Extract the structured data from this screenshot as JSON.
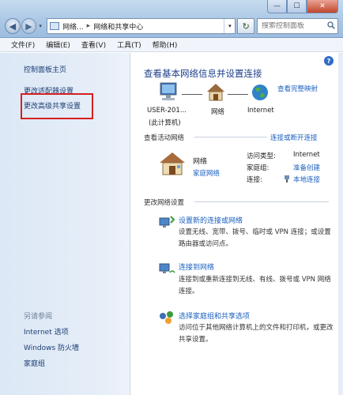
{
  "window": {
    "min_glyph": "—",
    "max_glyph": "☐",
    "close_glyph": "✕"
  },
  "nav": {
    "back_glyph": "◀",
    "fwd_glyph": "▶",
    "drop_glyph": "▾",
    "breadcrumb": [
      "网络...",
      "网络和共享中心"
    ],
    "breadcrumb_sep": "▸",
    "refresh_glyph": "↻",
    "search_placeholder": "搜索控制面板",
    "search_icon": "search-icon"
  },
  "menubar": {
    "items": [
      "文件(F)",
      "编辑(E)",
      "查看(V)",
      "工具(T)",
      "帮助(H)"
    ]
  },
  "sidebar": {
    "items": [
      {
        "label": "控制面板主页"
      },
      {
        "label": "更改适配器设置"
      },
      {
        "label": "更改高级共享设置"
      }
    ],
    "see_also_heading": "另请参阅",
    "see_also": [
      {
        "label": "Internet 选项"
      },
      {
        "label": "Windows 防火墙"
      },
      {
        "label": "家庭组"
      }
    ]
  },
  "main": {
    "help_glyph": "?",
    "title": "查看基本网络信息并设置连接",
    "full_map_link": "查看完整映射",
    "map": {
      "computer_label_1": "USER-201...",
      "computer_label_2": "(此计算机)",
      "network_label": "网络",
      "internet_label": "Internet"
    },
    "active_networks": {
      "heading": "查看活动网络",
      "connect_link": "连接或断开连接",
      "network_name": "网络",
      "network_type": "家庭网络",
      "access_type_label": "访问类型:",
      "access_type_value": "Internet",
      "homegroup_label": "家庭组:",
      "homegroup_value": "准备创建",
      "connection_label": "连接:",
      "connection_value": "本地连接"
    },
    "change_settings": {
      "heading": "更改网络设置",
      "tasks": [
        {
          "title": "设置新的连接或网络",
          "desc": "设置无线、宽带、拨号、临时或 VPN 连接；或设置路由器或访问点。"
        },
        {
          "title": "连接到网络",
          "desc": "连接到或重新连接到无线、有线、拨号或 VPN 网络连接。"
        },
        {
          "title": "选择家庭组和共享选项",
          "desc": "访问位于其他网络计算机上的文件和打印机，或更改共享设置。"
        }
      ]
    }
  },
  "colors": {
    "link": "#1b5fbf",
    "title": "#1d3f8c",
    "highlight_box": "#d62020"
  }
}
